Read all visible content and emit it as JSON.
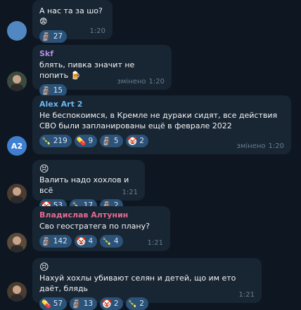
{
  "messages": [
    {
      "sender": "",
      "sender_color": "",
      "text": "А нас та за шо?😨",
      "emoji_line": "",
      "reactions": [
        {
          "emoji": "🗿",
          "count": "27"
        }
      ],
      "edited": "",
      "time": "1:20",
      "avatar": {
        "type": "blank",
        "color": "#5288c1",
        "initials": ""
      }
    },
    {
      "sender": "Skf",
      "sender_color": "#b18ee0",
      "text": "блять, пивка значит не попить 🍺",
      "emoji_line": "",
      "reactions": [
        {
          "emoji": "🗿",
          "count": "15"
        }
      ],
      "edited": "змінено",
      "time": "1:20",
      "avatar": {
        "type": "photo",
        "color": "#3d4a3f",
        "initials": ""
      }
    },
    {
      "sender": "Alex Art 2",
      "sender_color": "#6cb6f0",
      "text": "Не беспокоимся,  в Кремле не дураки сидят, все действия СВО были запланированы ещё в феврале 2022",
      "emoji_line": "",
      "reactions": [
        {
          "emoji": "🍾",
          "count": "219"
        },
        {
          "emoji": "💊",
          "count": "9"
        },
        {
          "emoji": "🗿",
          "count": "5"
        },
        {
          "emoji": "🤡",
          "count": "2"
        }
      ],
      "edited": "змінено",
      "time": "1:20",
      "avatar": {
        "type": "initials",
        "color": "#3e7fd1",
        "initials": "A2"
      }
    },
    {
      "sender": "",
      "sender_color": "",
      "text": "Валить надо хохлов и всё",
      "emoji_line": "😣",
      "reactions": [
        {
          "emoji": "🤡",
          "count": "53"
        },
        {
          "emoji": "🍾",
          "count": "17"
        },
        {
          "emoji": "🗿",
          "count": "2"
        }
      ],
      "edited": "",
      "time": "1:21",
      "avatar": {
        "type": "photo",
        "color": "#4a3c30",
        "initials": ""
      }
    },
    {
      "sender": "Владислав Алтунин",
      "sender_color": "#e56a8f",
      "text": "Сво геостратега по плану?",
      "emoji_line": "",
      "reactions": [
        {
          "emoji": "🗿",
          "count": "142"
        },
        {
          "emoji": "🤡",
          "count": "4"
        },
        {
          "emoji": "🍾",
          "count": "4"
        }
      ],
      "edited": "",
      "time": "1:21",
      "avatar": {
        "type": "photo",
        "color": "#5a4a3a",
        "initials": ""
      }
    },
    {
      "sender": "",
      "sender_color": "",
      "text": "Нахуй хохлы убивают селян и детей, що им ето даёт, блядь",
      "emoji_line": "😣",
      "reactions": [
        {
          "emoji": "💊",
          "count": "57"
        },
        {
          "emoji": "🗿",
          "count": "13"
        },
        {
          "emoji": "🤡",
          "count": "2"
        },
        {
          "emoji": "🍾",
          "count": "2"
        }
      ],
      "edited": "",
      "time": "1:21",
      "avatar": {
        "type": "photo",
        "color": "#4a3c30",
        "initials": ""
      }
    }
  ]
}
